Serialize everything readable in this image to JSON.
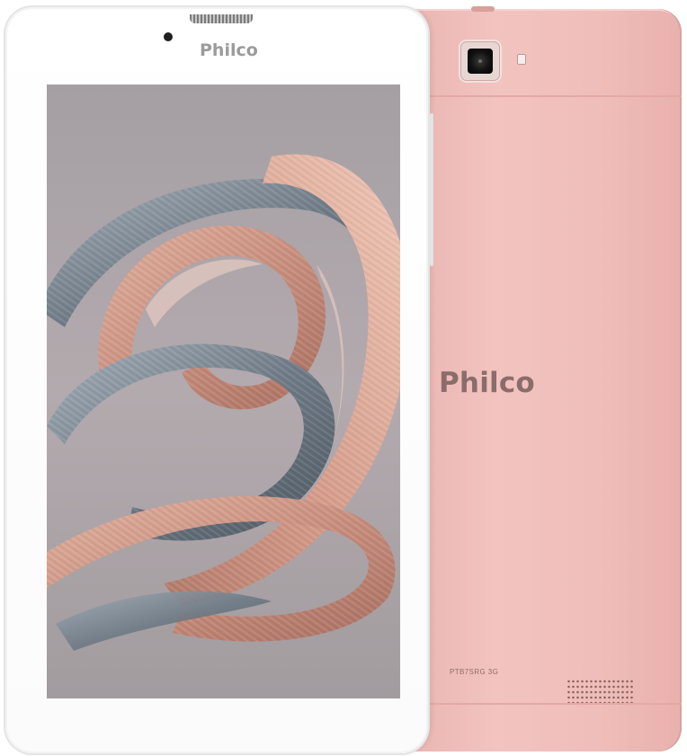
{
  "front": {
    "brand": "Philco"
  },
  "back": {
    "brand": "Philco",
    "model": "PTB7SRG 3G"
  },
  "colors": {
    "back_shell": "#f0beba",
    "front_frame": "#ffffff",
    "wallpaper_copper": "#c98f7e",
    "wallpaper_steel": "#6f7b86"
  }
}
